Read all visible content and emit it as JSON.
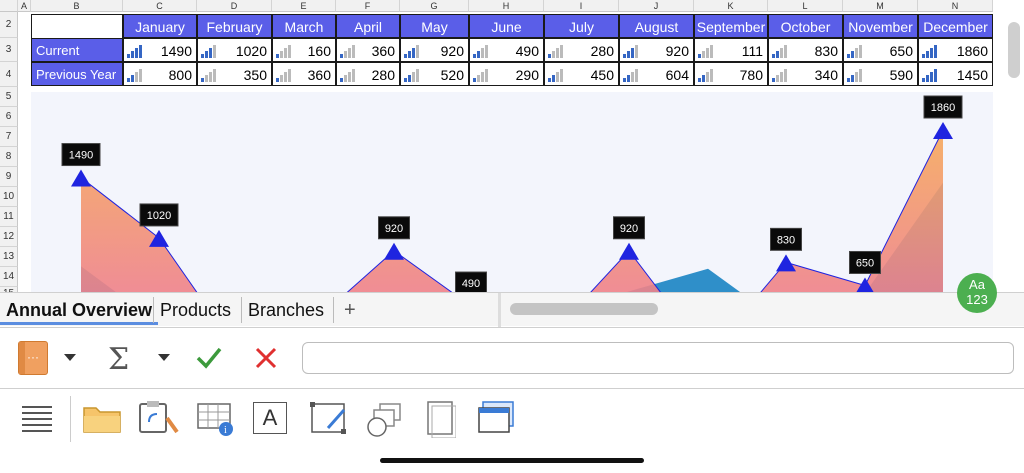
{
  "columns": [
    "A",
    "B",
    "C",
    "D",
    "E",
    "F",
    "G",
    "H",
    "I",
    "J",
    "K",
    "L",
    "M",
    "N"
  ],
  "rows": [
    "2",
    "3",
    "4",
    "5",
    "6",
    "7",
    "8",
    "9",
    "10",
    "11",
    "12",
    "13",
    "14",
    "15"
  ],
  "table": {
    "months": [
      "January",
      "February",
      "March",
      "April",
      "May",
      "June",
      "July",
      "August",
      "September",
      "October",
      "November",
      "December"
    ],
    "rows": [
      {
        "label": "Current",
        "values": [
          "1490",
          "1020",
          "160",
          "360",
          "920",
          "490",
          "280",
          "920",
          "111",
          "830",
          "650",
          "1860"
        ]
      },
      {
        "label": "Previous Year",
        "values": [
          "800",
          "350",
          "360",
          "280",
          "520",
          "290",
          "450",
          "604",
          "780",
          "340",
          "590",
          "1450"
        ]
      }
    ]
  },
  "chart_data": {
    "type": "area",
    "categories": [
      "January",
      "February",
      "March",
      "April",
      "May",
      "June",
      "July",
      "August",
      "September",
      "October",
      "November",
      "December"
    ],
    "series": [
      {
        "name": "Current",
        "values": [
          1490,
          1020,
          160,
          360,
          920,
          490,
          280,
          920,
          111,
          830,
          650,
          1860
        ]
      },
      {
        "name": "Previous Year",
        "values": [
          800,
          350,
          360,
          280,
          520,
          290,
          450,
          604,
          780,
          340,
          590,
          1450
        ]
      }
    ],
    "data_labels": [
      "1490",
      "1020",
      "",
      "",
      "920",
      "490",
      "",
      "920",
      "",
      "830",
      "650",
      "1860"
    ],
    "ylim": [
      0,
      2000
    ],
    "colors": {
      "current_top": "#f4a262",
      "current_bottom": "#ec6fa0",
      "previous": "#2f8fc9",
      "marker": "#1f24e0"
    }
  },
  "sheet_tabs": {
    "items": [
      "Annual Overview",
      "Products",
      "Branches"
    ],
    "add": "+"
  },
  "badge": {
    "line1": "Aa",
    "line2": "123"
  },
  "formula_bar": {
    "value": "",
    "sigma": "Σ"
  },
  "toolbar": {
    "text_icon": "A"
  }
}
